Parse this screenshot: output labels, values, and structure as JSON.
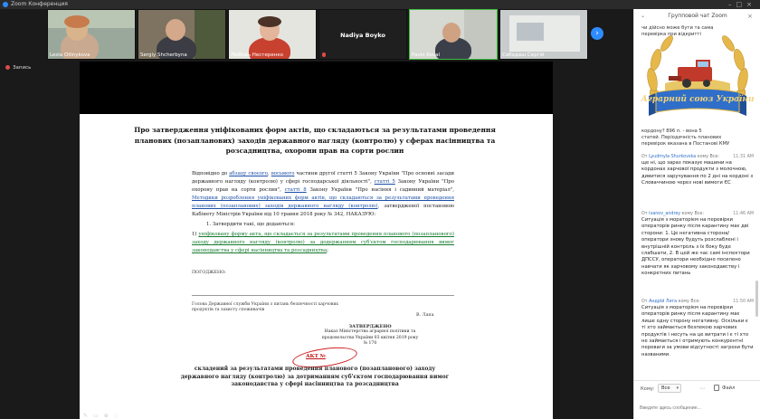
{
  "window": {
    "title": "Zoom Конференция"
  },
  "gallery": {
    "tiles": [
      {
        "name": "Lesia Oliinykova"
      },
      {
        "name": "Sergiy Shcherbyna"
      },
      {
        "name": "Любовь Нестеренко"
      },
      {
        "name": "Nadiya Boyko"
      },
      {
        "name": "Pavlo Koval"
      },
      {
        "name": "Сабадаш Сергій"
      }
    ]
  },
  "recording": {
    "label": "Запись"
  },
  "document": {
    "title": "Про затвердження уніфікованих форм актів, що складаються за результатами проведення планових (позапланових) заходів державного нагляду (контролю) у сферах насінництва та розсадництва, охорони прав на сорти рослин",
    "para1_a": "Відповідно до ",
    "para1_link1": "абзацу своєого",
    "para1_b": ", ",
    "para1_link2": "восьмого",
    "para1_c": " частини другої статті 5 Закону України \"Про основні засади державного нагляду (контролю) у сфері господарської діяльності\", ",
    "para1_link3": "статті 5",
    "para1_d": " Закону України \"Про охорону прав на сорти рослин\", ",
    "para1_link4": "статті 8",
    "para1_e": " Закону України \"Про насіння і садивний матеріал\", ",
    "para1_link5": "Методики розроблення уніфікованих форм актів, що складаються за результатами проведення планових (позапланових) заходів державного нагляду (контролю)",
    "para1_f": ", затвердженої постановою Кабінету Міністрів України від 10 травня 2018 року № 342,  НАКАЗУЮ:",
    "item1": "1. Затвердити такі, що додаються:",
    "item2_a": "1) ",
    "item2_link": "уніфіковану форму акта, що складається за результатами проведення планового (позапланового) заходу державного нагляду (контролю) за додержанням суб'єктом господарювання вимог законодавства у сфері насінництва та розсадництва",
    "item2_b": ";",
    "sign_head": "ПОГОДЖЕНО:",
    "sign_block": "Голова Державної служби України з питань безпечності харчових продуктів та захисту споживачів",
    "sign_name": "В. Лапа",
    "approve_title": "ЗАТВЕРДЖЕНО",
    "approve_body": "Наказ Міністерства аграрної політики та продовольства України 03 квітня 2019 року № 170",
    "act_title": "АКТ №",
    "act_body": "складений за результатами проведення планового (позапланового) заходу державного нагляду (контролю) за дотриманням суб'єктом господарювання вимог законодавства у сфері насінництва та розсадництва"
  },
  "chat": {
    "header": "Групповой чат Zoom",
    "fragments": [
      "чи дійсно може бути та сама",
      "перевірка при відкритті",
      "кордону? 896 п. - вона 5",
      "статей. Періодичність планових",
      "перевірок вказана в Постанові КМУ"
    ],
    "messages": [
      {
        "from_prefix": "От",
        "from": "Lyudmyla Shurkovska",
        "to": "кому Все:",
        "time": "11:31 AM",
        "text": "ще ні, що зараз показує машини на кордонах харчової продукти з молочною, дивитися заручування по 2 дні на кордоні з Словаччиною через нові вимоги ЄС"
      },
      {
        "from_prefix": "От",
        "from": "ivanov_andrey",
        "to": "кому Все:",
        "time": "11:46 AM",
        "text": "Ситуація з мораторієм на перевірки операторів ринку після карантину має дві сторони: 1. Це негативна сторона/оператори знову будуть розслаблені і внутрішній контроль з їх боку буде слабшати, 2. В цей же час самі інспектори ДПССУ, оператори необхідно посилено навчати як харчовому законодавству і конкретних питань"
      },
      {
        "from_prefix": "От",
        "from": "Андрій Лига",
        "to": "кому Все:",
        "time": "11:50 AM",
        "text": "Ситуація з мораторієм на перевірки операторів ринку після карантину має лише одну сторону негативну. Оскільки є ті хто займається безпекою харчових продуктів і несуть на це витрати і є ті хто не займається і отримують конкурентні переваги за умови відсутності загрози бути названими."
      }
    ],
    "to_label": "Кому:",
    "to_value": "Все",
    "file_label": "Файл",
    "input_placeholder": "Введите здесь сообщение..."
  },
  "logo": {
    "banner_text": "Аграрний союз України",
    "colors": {
      "ribbon": "#2f6fc9",
      "wheat": "#e6b84a",
      "machine": "#c0392b"
    }
  }
}
